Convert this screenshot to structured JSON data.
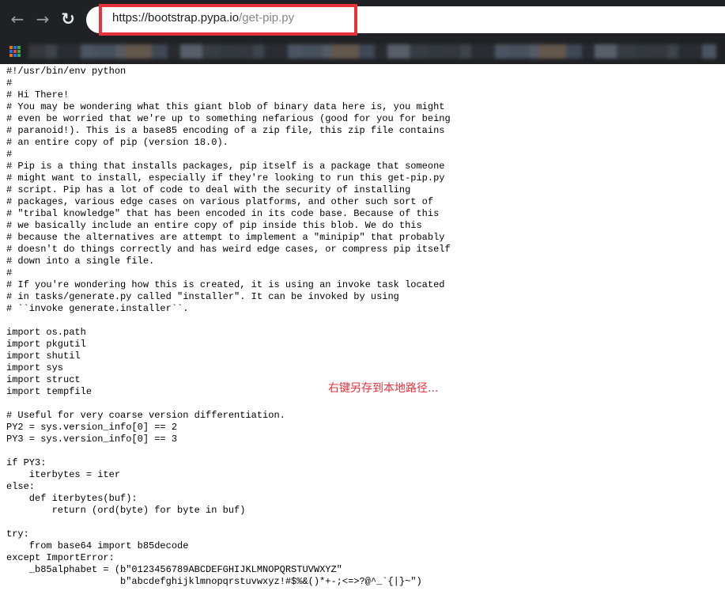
{
  "browser": {
    "url_host": "https://bootstrap.pypa.io",
    "url_path": "/get-pip.py",
    "back_glyph": "←",
    "forward_glyph": "→",
    "reload_glyph": "↻",
    "highlight_color": "#e8313a"
  },
  "icons": {
    "back": "arrow-left",
    "forward": "arrow-right",
    "reload": "reload",
    "apps": "apps-grid"
  },
  "source_lines": [
    "#!/usr/bin/env python",
    "#",
    "# Hi There!",
    "# You may be wondering what this giant blob of binary data here is, you might",
    "# even be worried that we're up to something nefarious (good for you for being",
    "# paranoid!). This is a base85 encoding of a zip file, this zip file contains",
    "# an entire copy of pip (version 18.0).",
    "#",
    "# Pip is a thing that installs packages, pip itself is a package that someone",
    "# might want to install, especially if they're looking to run this get-pip.py",
    "# script. Pip has a lot of code to deal with the security of installing",
    "# packages, various edge cases on various platforms, and other such sort of",
    "# \"tribal knowledge\" that has been encoded in its code base. Because of this",
    "# we basically include an entire copy of pip inside this blob. We do this",
    "# because the alternatives are attempt to implement a \"minipip\" that probably",
    "# doesn't do things correctly and has weird edge cases, or compress pip itself",
    "# down into a single file.",
    "#",
    "# If you're wondering how this is created, it is using an invoke task located",
    "# in tasks/generate.py called \"installer\". It can be invoked by using",
    "# ``invoke generate.installer``.",
    "",
    "import os.path",
    "import pkgutil",
    "import shutil",
    "import sys",
    "import struct",
    "import tempfile",
    "",
    "# Useful for very coarse version differentiation.",
    "PY2 = sys.version_info[0] == 2",
    "PY3 = sys.version_info[0] == 3",
    "",
    "if PY3:",
    "    iterbytes = iter",
    "else:",
    "    def iterbytes(buf):",
    "        return (ord(byte) for byte in buf)",
    "",
    "try:",
    "    from base64 import b85decode",
    "except ImportError:",
    "    _b85alphabet = (b\"0123456789ABCDEFGHIJKLMNOPQRSTUVWXYZ\"",
    "                    b\"abcdefghijklmnopqrstuvwxyz!#$%&()*+-;<=>?@^_`{|}~\")"
  ],
  "annotation": "右键另存到本地路径..."
}
